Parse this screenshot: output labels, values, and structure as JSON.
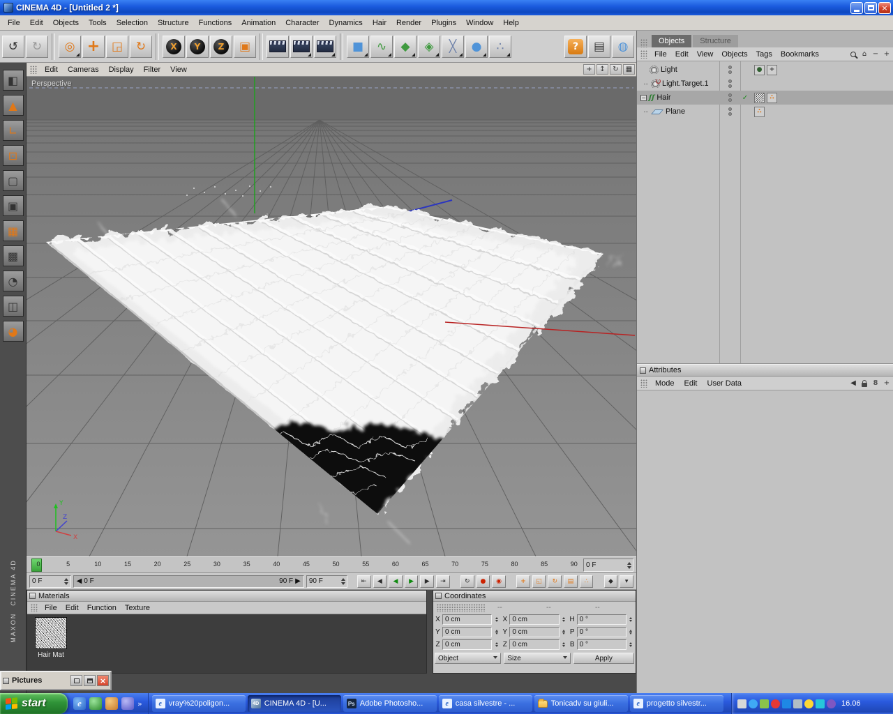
{
  "titlebar": {
    "title": "CINEMA 4D - [Untitled 2 *]"
  },
  "menu_bar": {
    "items": [
      "File",
      "Edit",
      "Objects",
      "Tools",
      "Selection",
      "Structure",
      "Functions",
      "Animation",
      "Character",
      "Dynamics",
      "Hair",
      "Render",
      "Plugins",
      "Window",
      "Help"
    ]
  },
  "icons": {
    "undo": "↺",
    "redo": "↻",
    "live_selection": "◎",
    "move": "+",
    "scale": "◲",
    "rotate": "↻",
    "coord_system": "▣",
    "axis_x": "X",
    "axis_y": "Y",
    "axis_z": "Z",
    "cube": "■",
    "spline": "∿",
    "nurbs": "◆",
    "modeling": "◈",
    "deformer": "╳",
    "scene": "●",
    "particles": "∴",
    "help": "?",
    "command": "▤",
    "browser": "◍",
    "l_make_editable": "◧",
    "l_model": "▲",
    "l_axis": "∟",
    "l_point": "⊡",
    "l_edge": "▢",
    "l_poly": "▣",
    "l_texture": "▦",
    "l_texture_axis": "▩",
    "l_anim": "◔",
    "l_workplane": "◫",
    "l_solo": "◕",
    "pan": "+",
    "zoom": "↕",
    "rotate_view": "↻",
    "views": "▦",
    "goto_start": "⇤",
    "prev_frame": "◀",
    "play_back": "◀",
    "play": "▶",
    "next_frame": "▶",
    "goto_end": "⇥",
    "loop": "↻",
    "record": "●",
    "autokey": "◉",
    "rec_pos": "+",
    "rec_scale": "◱",
    "rec_rot": "↻",
    "rec_param": "▤",
    "rec_pla": "∴",
    "key": "◆",
    "opts": "▾",
    "left_arrow": "◀",
    "right_arrow": "▶",
    "back": "◀",
    "home": "⌂",
    "minus": "−",
    "plus": "+",
    "collapse": "−",
    "check": "✓",
    "link": "8",
    "hair_glyph": "ʃʃ",
    "tag_sphere": "●",
    "tag_cross": "+",
    "tag_dots": "∴",
    "close": "×",
    "ie": "e",
    "ps": "Ps",
    "c4d": "4D",
    "chevron": "»"
  },
  "viewport": {
    "label": "Perspective",
    "menu": [
      "Edit",
      "Cameras",
      "Display",
      "Filter",
      "View"
    ]
  },
  "timeline": {
    "ticks": [
      "0",
      "5",
      "10",
      "15",
      "20",
      "25",
      "30",
      "35",
      "40",
      "45",
      "50",
      "55",
      "60",
      "65",
      "70",
      "75",
      "80",
      "85",
      "90"
    ],
    "current_frame": "0 F",
    "start_frame": "0 F",
    "end_frame": "90 F",
    "range_left": "0 F",
    "range_right": "90 F"
  },
  "materials": {
    "title": "Materials",
    "menu": [
      "File",
      "Edit",
      "Function",
      "Texture"
    ],
    "items": [
      {
        "name": "Hair Mat"
      }
    ]
  },
  "coordinates": {
    "title": "Coordinates",
    "headers": [
      "--",
      "--",
      "--"
    ],
    "rows": [
      {
        "pos_label": "X",
        "pos_value": "0 cm",
        "size_label": "X",
        "size_value": "0 cm",
        "rot_label": "H",
        "rot_value": "0 °"
      },
      {
        "pos_label": "Y",
        "pos_value": "0 cm",
        "size_label": "Y",
        "size_value": "0 cm",
        "rot_label": "P",
        "rot_value": "0 °"
      },
      {
        "pos_label": "Z",
        "pos_value": "0 cm",
        "size_label": "Z",
        "size_value": "0 cm",
        "rot_label": "B",
        "rot_value": "0 °"
      }
    ],
    "mode_dropdown": "Object",
    "size_dropdown": "Size",
    "apply_button": "Apply"
  },
  "object_manager": {
    "tabs": [
      {
        "label": "Objects"
      },
      {
        "label": "Structure"
      }
    ],
    "menu": [
      "File",
      "Edit",
      "View",
      "Objects",
      "Tags",
      "Bookmarks"
    ],
    "items": [
      {
        "name": "Light"
      },
      {
        "name": "Light.Target.1"
      },
      {
        "name": "Hair"
      },
      {
        "name": "Plane"
      }
    ]
  },
  "attributes": {
    "title": "Attributes",
    "menu": [
      "Mode",
      "Edit",
      "User Data"
    ]
  },
  "pictures_window": {
    "title": "Pictures"
  },
  "branding": {
    "line1": "MAXON",
    "line2": "CINEMA 4D"
  },
  "taskbar": {
    "start_label": "start",
    "buttons": [
      {
        "label": "vray%20poligon..."
      },
      {
        "label": "CINEMA 4D - [U..."
      },
      {
        "label": "Adobe Photosho..."
      },
      {
        "label": "casa silvestre - ..."
      },
      {
        "label": "Tonicadv su giuli..."
      },
      {
        "label": "progetto silvestr..."
      }
    ],
    "clock": "16.06"
  }
}
